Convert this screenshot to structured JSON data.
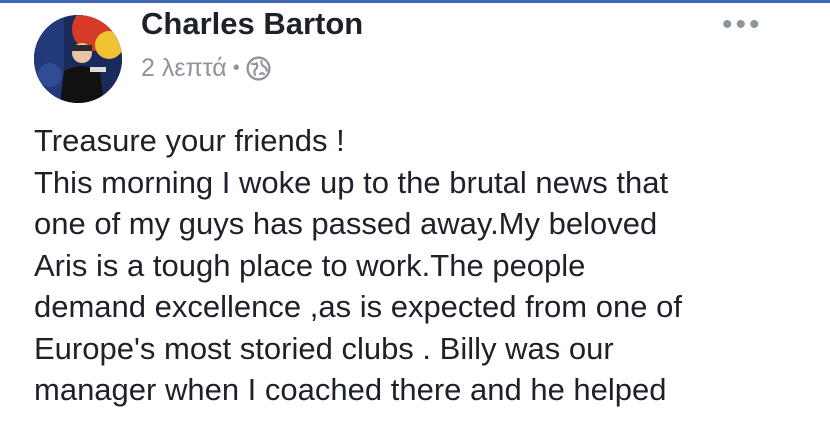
{
  "post": {
    "author": "Charles Barton",
    "timestamp": "2 λεπτά",
    "separator": "•",
    "privacy_icon": "globe-icon",
    "more_icon": "more-options-icon",
    "more_label": "•••",
    "lines": [
      "Treasure your friends !",
      "This morning I woke up to the brutal news that",
      "one of my guys has passed away.My beloved",
      "Aris is a tough place to work.The people",
      "demand excellence ,as is expected from one of",
      "Europe's most storied clubs . Billy was our",
      "manager when I coached there and he helped"
    ]
  },
  "colors": {
    "accent": "#4267b2",
    "text": "#1d2129",
    "meta": "#90949c"
  }
}
